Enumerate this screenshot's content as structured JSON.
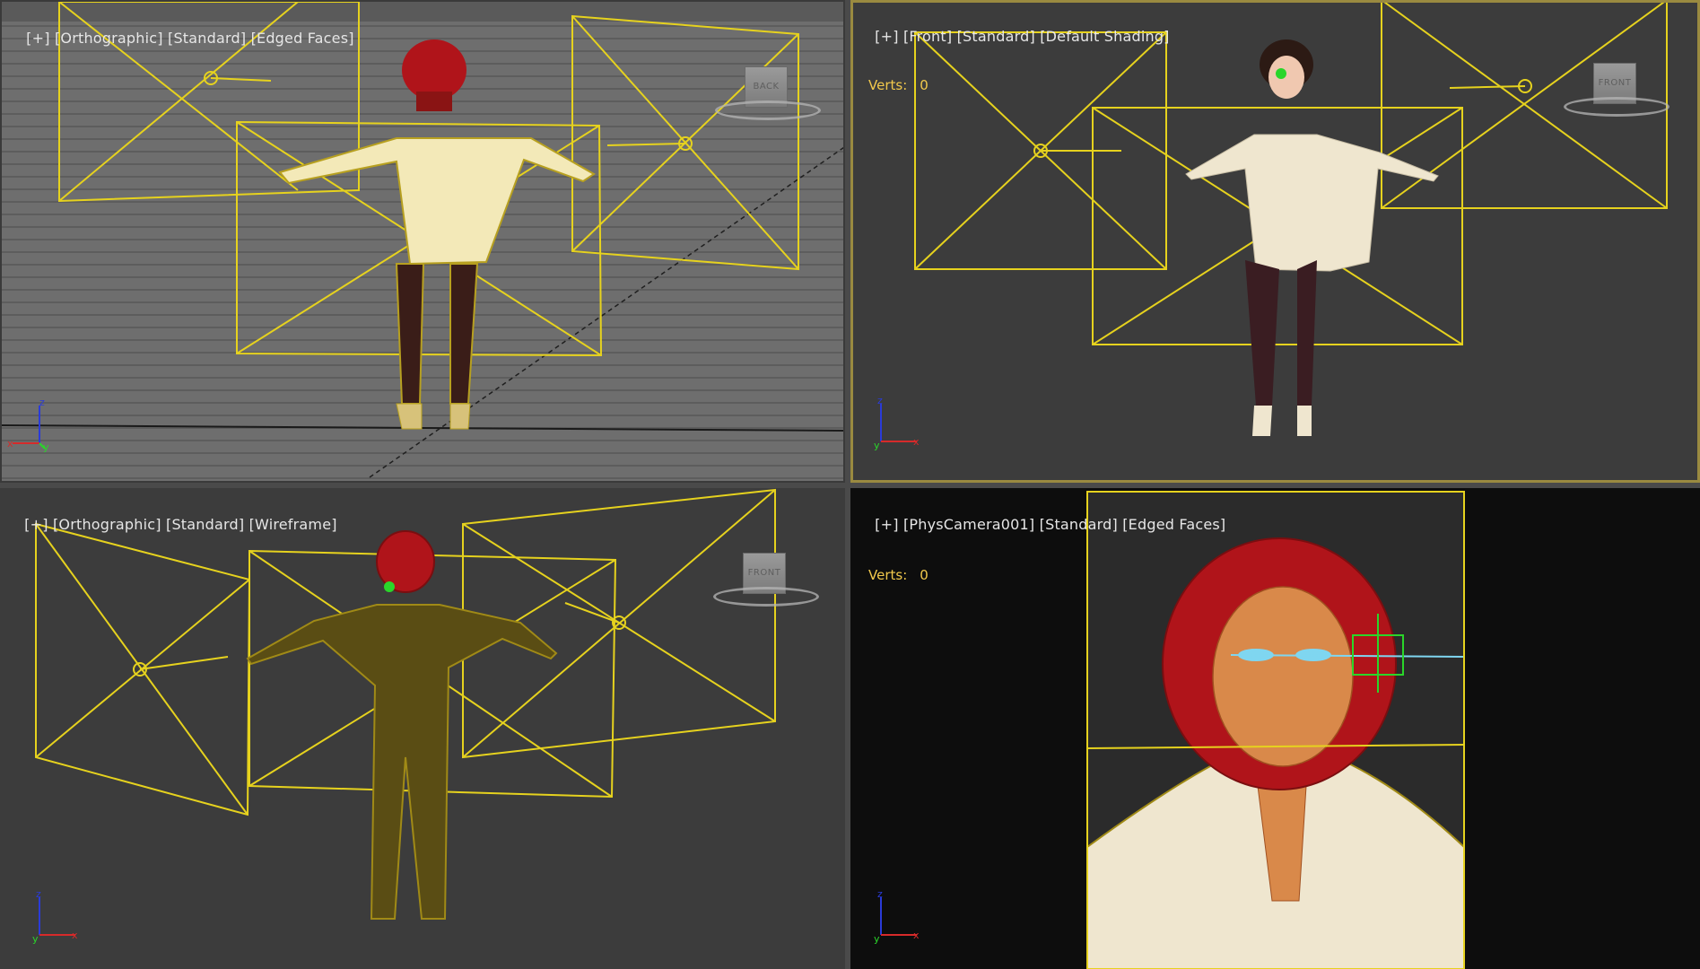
{
  "viewports": [
    {
      "id": "top-left",
      "labels": [
        "[+]",
        "[Orthographic]",
        "[Standard]",
        "[Edged Faces]"
      ],
      "viewcube_face": "BACK"
    },
    {
      "id": "top-right",
      "labels": [
        "[+]",
        "[Front]",
        "[Standard]",
        "[Default Shading]"
      ],
      "stats_label": "Verts:",
      "stats_value": "0",
      "viewcube_face": "FRONT"
    },
    {
      "id": "bottom-left",
      "labels": [
        "[+]",
        "[Orthographic]",
        "[Standard]",
        "[Wireframe]"
      ],
      "viewcube_face": "FRONT"
    },
    {
      "id": "bottom-right",
      "labels": [
        "[+]",
        "[PhysCamera001]",
        "[Standard]",
        "[Edged Faces]"
      ],
      "stats_label": "Verts:",
      "stats_value": "0"
    }
  ],
  "axis_labels": {
    "x": "x",
    "y": "y",
    "z": "z"
  },
  "colors": {
    "selection_yellow": "#e6d21e",
    "hair_red": "#b0141a",
    "shirt_cream": "#efe6cf",
    "pants_dark": "#3a1d22",
    "wire_gold": "#a08a16",
    "active_border": "#9a8a40",
    "stats_text": "#f2c94c"
  }
}
